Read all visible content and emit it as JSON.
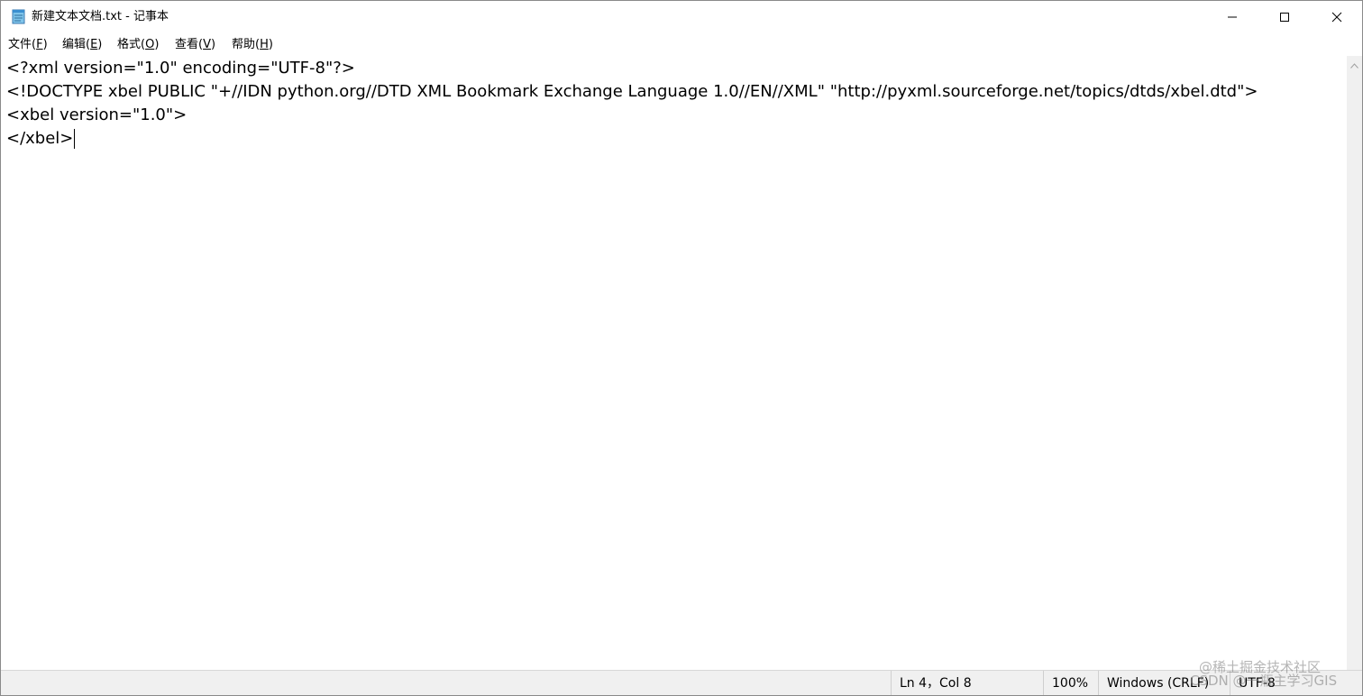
{
  "window": {
    "title": "新建文本文档.txt - 记事本",
    "icon": "notepad-icon"
  },
  "titlebar_buttons": {
    "minimize": "minimize-icon",
    "maximize": "maximize-icon",
    "close": "close-icon"
  },
  "menu": {
    "items": [
      {
        "label": "文件(",
        "accel": "F",
        "suffix": ")"
      },
      {
        "label": "编辑(",
        "accel": "E",
        "suffix": ")"
      },
      {
        "label": "格式(",
        "accel": "O",
        "suffix": ")"
      },
      {
        "label": "查看(",
        "accel": "V",
        "suffix": ")"
      },
      {
        "label": "帮助(",
        "accel": "H",
        "suffix": ")"
      }
    ]
  },
  "editor": {
    "lines": [
      "<?xml version=\"1.0\" encoding=\"UTF-8\"?>",
      "<!DOCTYPE xbel PUBLIC \"+//IDN python.org//DTD XML Bookmark Exchange Language 1.0//EN//XML\" \"http://pyxml.sourceforge.net/topics/dtds/xbel.dtd\">",
      "<xbel version=\"1.0\">",
      "</xbel>"
    ]
  },
  "statusbar": {
    "position": "Ln 4，Col 8",
    "zoom": "100%",
    "line_ending": "Windows (CRLF)",
    "encoding": "UTF-8"
  },
  "watermark": {
    "line1": "@稀土掘金技术社区",
    "line2": "CSDN @一瓶主学习GIS"
  }
}
